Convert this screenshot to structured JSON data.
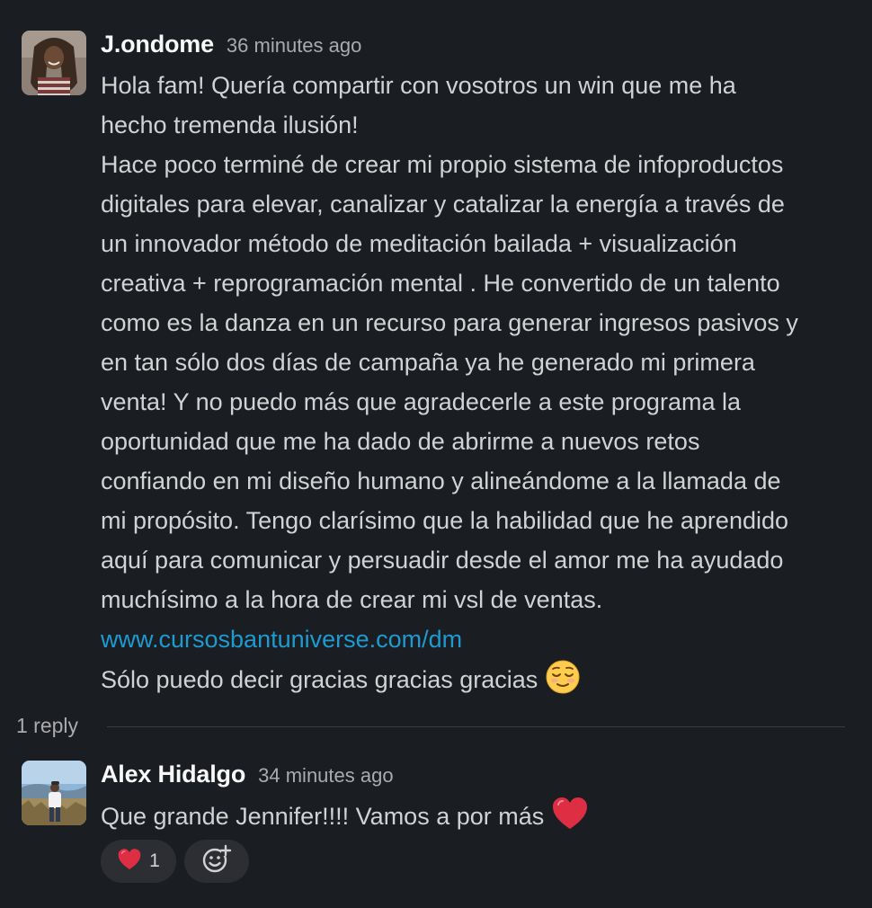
{
  "colors": {
    "background": "#1a1d21",
    "text": "#d1d2d3",
    "author": "#f8f8f8",
    "timestamp": "#ababad",
    "link": "#1d9bd1",
    "pill": "#2c2e33"
  },
  "message": {
    "author": "J.ondome",
    "timestamp": "36 minutes ago",
    "avatar_icon": "user-avatar",
    "lines": [
      "Hola fam! Quería compartir con vosotros un win que me ha",
      "hecho tremenda ilusión!",
      "Hace poco terminé de crear mi propio sistema de infoproductos",
      "digitales para elevar, canalizar y catalizar la energía a través de",
      "un innovador método de meditación bailada + visualización",
      "creativa + reprogramación mental . He convertido de un talento",
      "como es la danza en un recurso para generar ingresos pasivos y",
      "en tan sólo dos días de campaña ya he generado mi primera",
      "venta! Y no puedo más que agradecerle a este programa la",
      "oportunidad que me ha dado de abrirme a nuevos retos",
      "confiando en mi diseño humano y alineándome a la llamada de",
      "mi propósito. Tengo clarísimo que la habilidad que he aprendido",
      "aquí para comunicar y persuadir desde el amor me ha ayudado",
      "muchísimo a la hora de crear mi vsl de ventas."
    ],
    "link": "www.cursosbantuniverse.com/dm",
    "closing": "Sólo puedo decir gracias gracias gracias",
    "closing_emoji": "relieved-face-emoji"
  },
  "thread": {
    "reply_count": "1 reply"
  },
  "reply": {
    "author": "Alex Hidalgo",
    "timestamp": "34 minutes ago",
    "avatar_icon": "user-avatar",
    "text": "Que grande Jennifer!!!! Vamos a por más",
    "text_emoji": "red-heart-emoji"
  },
  "reactions": [
    {
      "emoji": "red-heart-emoji",
      "count": "1"
    }
  ],
  "add_reaction_icon": "add-reaction-icon"
}
